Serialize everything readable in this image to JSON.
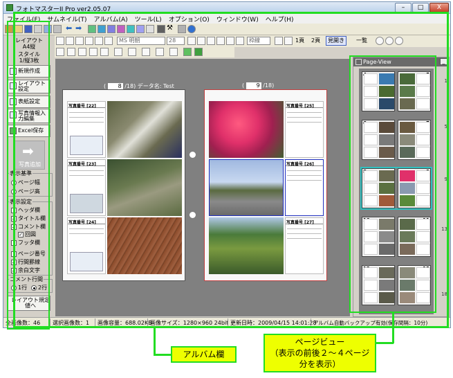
{
  "window": {
    "title": "フォトマスターII Pro ver2.05.07",
    "buttons": {
      "minimize": "–",
      "maximize": "□",
      "close": "X"
    }
  },
  "menu": [
    "ファイル(F)",
    "サムネイル(T)",
    "アルバム(A)",
    "ツール(L)",
    "オプション(O)",
    "ウィンドウ(W)",
    "ヘルプ(H)"
  ],
  "left_panel": {
    "layout_label": "レイアウト",
    "paper": "A4縦",
    "style_label": "スタイル",
    "style_value": "1/縦3枚",
    "buttons": [
      "新規作成",
      "レイアウト設定",
      "表紙設定",
      "写真情報入力編集",
      "Excel保存"
    ],
    "big_button": "写真追加",
    "display_group": {
      "title": "表示基準",
      "options": [
        "ページ幅",
        "ページ高"
      ],
      "selected": "ページ幅"
    },
    "settings_group": {
      "title": "表示設定",
      "items": [
        {
          "label": "ヘッダ欄",
          "checked": false
        },
        {
          "label": "タイトル欄",
          "checked": true
        },
        {
          "label": "コメント欄",
          "checked": true
        },
        {
          "label": "回図",
          "checked": true
        },
        {
          "label": "フッタ欄",
          "checked": false
        },
        {
          "label": "ページ番号",
          "checked": false
        },
        {
          "label": "行間罫線",
          "checked": true
        },
        {
          "label": "余白文字",
          "checked": true
        }
      ]
    },
    "line_group": {
      "title": "コメント行間",
      "options": [
        "1行",
        "2行"
      ],
      "selected": "2行"
    },
    "reset_button": "レイアウト規定値へ"
  },
  "format_toolbar": {
    "font": "MS 明朝",
    "size": "28",
    "frame": "枠線",
    "view_1page": "1頁",
    "view_2page": "2頁",
    "view_spread": "見開き",
    "view_list": "一覧"
  },
  "album": {
    "left_page": {
      "page": "8",
      "total": "/18",
      "data_label": "データ名:",
      "data_name": "Test"
    },
    "right_page": {
      "page": "9",
      "total": "/18"
    },
    "photo_headers": [
      "写真番号 [22]",
      "写真番号 [23]",
      "写真番号 [24]",
      "写真番号 [25]",
      "写真番号 [26]",
      "写真番号 [27]"
    ]
  },
  "page_view": {
    "title": "Page-View",
    "min": "_",
    "thumb_pairs": [
      [
        "4",
        "5"
      ],
      [
        "6",
        "7"
      ],
      [
        "8",
        "9"
      ],
      [
        "10",
        "11"
      ],
      [
        "12",
        "13"
      ]
    ],
    "scale_marks": [
      "1",
      "5",
      "9",
      "13",
      "18"
    ]
  },
  "status": {
    "total_images": "全画像数：46",
    "selected_images": "選択画像数：1",
    "image_size": "画像容量：688.02KB",
    "image_dims": "画像サイズ：1280×960 24bit",
    "updated": "更新日時：2009/04/15 14:01:28",
    "backup": "アルバム自動バックアップ有効(保存間隔：10分)"
  },
  "callouts": {
    "album": "アルバム欄",
    "pageview_line1": "ページビュー",
    "pageview_line2": "（表示の前後２～４ページ",
    "pageview_line3": "分を表示）"
  },
  "colors": {
    "highlight": "#22dd22",
    "callout_bg": "#eeff00",
    "canvas": "#808080"
  }
}
